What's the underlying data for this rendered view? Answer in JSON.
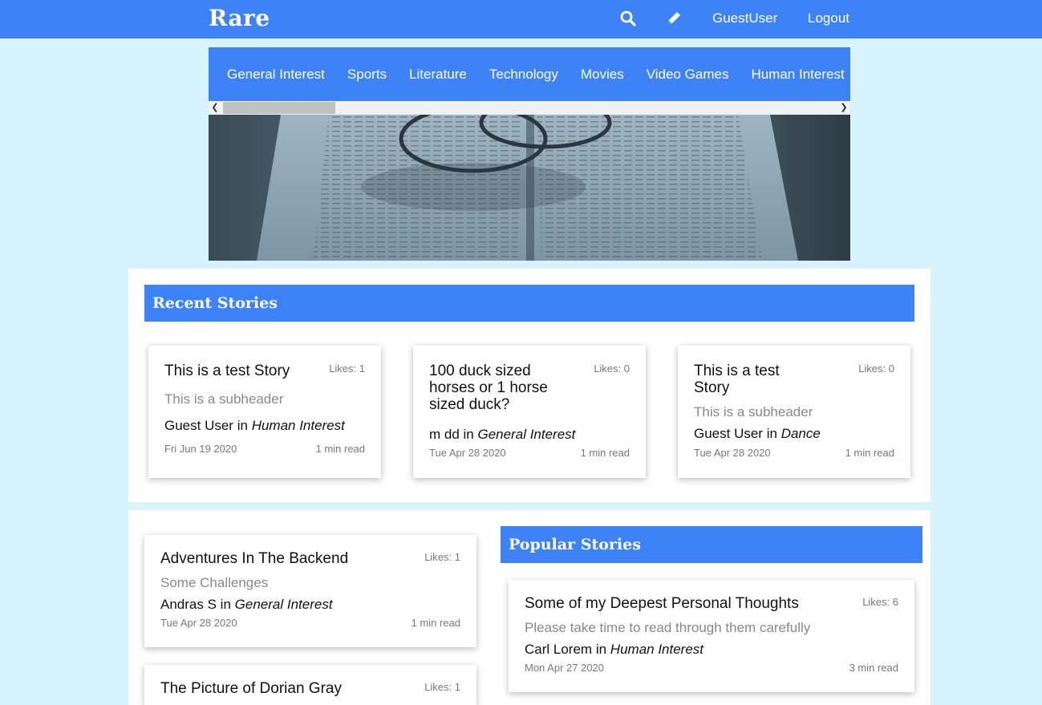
{
  "header": {
    "brand": "Rare",
    "user": "GuestUser",
    "logout": "Logout",
    "icons": [
      "search-icon",
      "pencil-icon"
    ]
  },
  "categories": [
    "General Interest",
    "Sports",
    "Literature",
    "Technology",
    "Movies",
    "Video Games",
    "Human Interest"
  ],
  "recent": {
    "title": "Recent Stories",
    "cards": [
      {
        "title": "This is a test Story",
        "likes": "Likes: 1",
        "subheader": "This is a subheader",
        "author": "Guest User",
        "in": "in",
        "category": "Human Interest",
        "date": "Fri Jun 19 2020",
        "read": "1 min read"
      },
      {
        "title": "100 duck sized horses or 1 horse sized duck?",
        "likes": "Likes: 0",
        "subheader": "",
        "author": "m dd",
        "in": "in",
        "category": "General Interest",
        "date": "Tue Apr 28 2020",
        "read": "1 min read"
      },
      {
        "title": "This is a test Story",
        "likes": "Likes: 0",
        "subheader": "This is a subheader",
        "author": "Guest User",
        "in": "in",
        "category": "Dance",
        "date": "Tue Apr 28 2020",
        "read": "1 min read"
      }
    ]
  },
  "left_stories": [
    {
      "title": "Adventures In The Backend",
      "likes": "Likes: 1",
      "subheader": "Some Challenges",
      "author": "Andras S",
      "in": "in",
      "category": "General Interest",
      "date": "Tue Apr 28 2020",
      "read": "1 min read"
    },
    {
      "title": "The Picture of Dorian Gray",
      "likes": "Likes: 1"
    }
  ],
  "popular": {
    "title": "Popular Stories",
    "cards": [
      {
        "title": "Some of my Deepest Personal Thoughts",
        "likes": "Likes: 6",
        "subheader": "Please take time to read through them carefully",
        "author": "Carl Lorem",
        "in": "in",
        "category": "Human Interest",
        "date": "Mon Apr 27 2020",
        "read": "3 min read"
      }
    ]
  },
  "colors": {
    "accent": "#3d82f7",
    "background": "#d7f4fe"
  }
}
